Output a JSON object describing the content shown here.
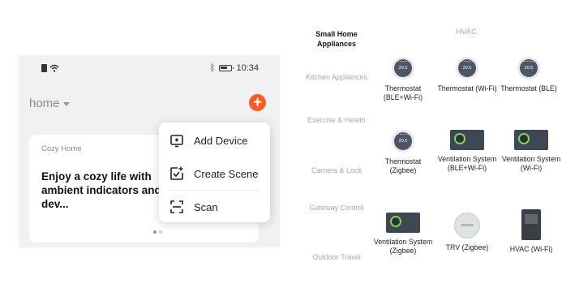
{
  "phone": {
    "status_bar": {
      "time": "10:34",
      "icons": [
        "sim-icon",
        "wifi-icon",
        "bluetooth-icon",
        "battery-icon"
      ]
    },
    "home_selector": {
      "label": "home"
    },
    "add_button": {
      "icon": "plus-icon",
      "color": "#ff5a22"
    },
    "card": {
      "eyebrow": "Cozy Home",
      "headline": "Enjoy a cozy life with ambient indicators and dev..."
    },
    "menu": {
      "items": [
        {
          "label": "Add Device",
          "icon": "add-device-icon"
        },
        {
          "label": "Create Scene",
          "icon": "create-scene-icon"
        },
        {
          "label": "Scan",
          "icon": "scan-icon"
        }
      ]
    }
  },
  "catalog": {
    "categories": [
      {
        "label": "Small Home Appliances",
        "active": true
      },
      {
        "label": "Kitchen Appliances",
        "active": false
      },
      {
        "label": "Exercise & Health",
        "active": false
      },
      {
        "label": "Camera & Lock",
        "active": false
      },
      {
        "label": "Gateway Control",
        "active": false
      },
      {
        "label": "Outdoor Travel",
        "active": false
      }
    ],
    "section_header": "HVAC",
    "products": [
      {
        "name": "Thermostat (BLE+Wi-Fi)",
        "kind": "thermostat",
        "display": "20.5"
      },
      {
        "name": "Thermostat (Wi-Fi)",
        "kind": "thermostat",
        "display": "20.5"
      },
      {
        "name": "Thermostat (BLE)",
        "kind": "thermostat",
        "display": "20.5"
      },
      {
        "name": "Thermostat (Zigbee)",
        "kind": "thermostat",
        "display": "20.5"
      },
      {
        "name": "Ventilation System (BLE+Wi-Fi)",
        "kind": "ventilation",
        "display": ""
      },
      {
        "name": "Ventilation System (Wi-Fi)",
        "kind": "ventilation",
        "display": ""
      },
      {
        "name": "Ventilation System (Zigbee)",
        "kind": "ventilation",
        "display": ""
      },
      {
        "name": "TRV (Zigbee)",
        "kind": "trv",
        "display": ""
      },
      {
        "name": "HVAC (Wi-Fi)",
        "kind": "hvac",
        "display": ""
      }
    ]
  }
}
